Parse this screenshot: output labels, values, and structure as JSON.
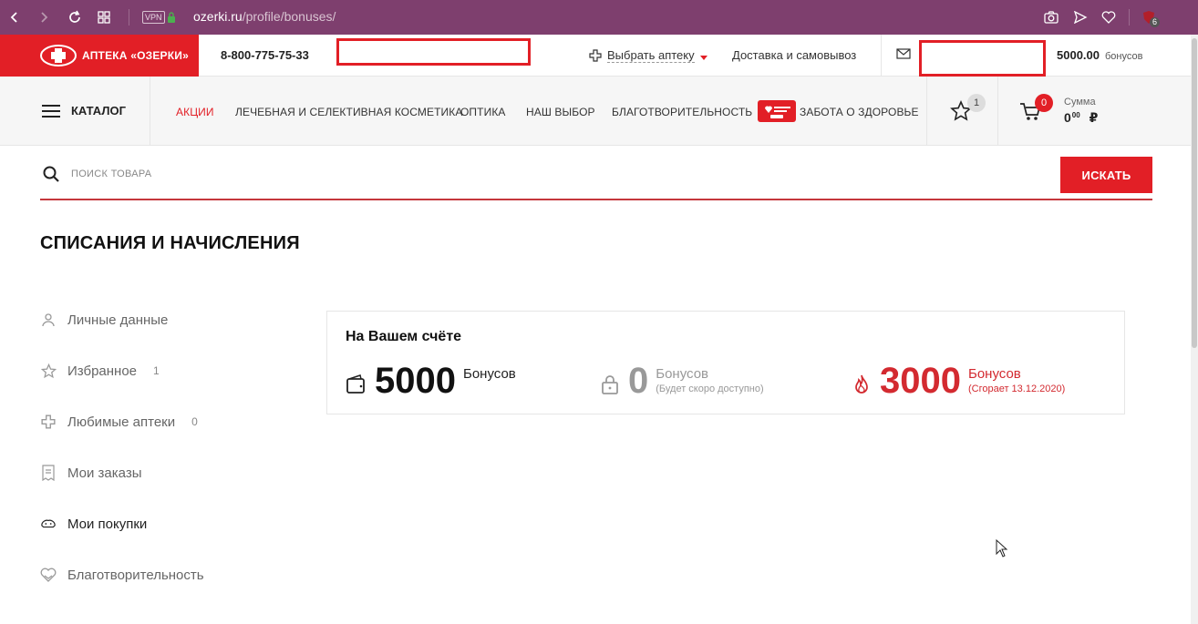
{
  "browser": {
    "url_host": "ozerki.ru",
    "url_path": "/profile/bonuses/",
    "vpn_label": "VPN",
    "extension_badge": "6"
  },
  "header": {
    "logo_text": "АПТЕКА «ОЗЕРКИ»",
    "phone": "8-800-775-75-33",
    "choose_pharmacy": "Выбрать аптеку",
    "delivery": "Доставка и самовывоз",
    "bonus_amount": "5000.00",
    "bonus_label": "бонусов"
  },
  "nav": {
    "catalog": "КАТАЛОГ",
    "items": [
      {
        "label": "АКЦИИ"
      },
      {
        "label": "ЛЕЧЕБНАЯ И СЕЛЕКТИВНАЯ КОСМЕТИКА"
      },
      {
        "label": "ОПТИКА"
      },
      {
        "label": "НАШ ВЫБОР"
      },
      {
        "label": "БЛАГОТВОРИТЕЛЬНОСТЬ"
      },
      {
        "label": "ЗАБОТА О ЗДОРОВЬЕ"
      }
    ],
    "favorites_count": "1",
    "cart_count": "0",
    "sum_label": "Сумма",
    "sum_value": "0",
    "sum_cents": "00",
    "currency": "₽"
  },
  "search": {
    "placeholder": "ПОИСК ТОВАРА",
    "button": "ИСКАТЬ"
  },
  "page": {
    "title": "СПИСАНИЯ И НАЧИСЛЕНИЯ"
  },
  "sidebar": {
    "items": [
      {
        "label": "Личные данные",
        "count": "",
        "icon": "user-icon"
      },
      {
        "label": "Избранное",
        "count": "1",
        "icon": "star-icon"
      },
      {
        "label": "Любимые аптеки",
        "count": "0",
        "icon": "cross-icon"
      },
      {
        "label": "Мои заказы",
        "count": "",
        "icon": "receipt-icon"
      },
      {
        "label": "Мои покупки",
        "count": "",
        "icon": "purchases-icon"
      },
      {
        "label": "Благотворительность",
        "count": "",
        "icon": "charity-icon"
      }
    ]
  },
  "bonus_card": {
    "title": "На Вашем счёте",
    "available": {
      "value": "5000",
      "label": "Бонусов"
    },
    "pending": {
      "value": "0",
      "label": "Бонусов",
      "note": "(Будет скоро доступно)"
    },
    "expiring": {
      "value": "3000",
      "label": "Бонусов",
      "note": "(Сгорает 13.12.2020)"
    }
  },
  "colors": {
    "brand_red": "#e21f26",
    "browser_purple": "#7e3f6e",
    "muted_gray": "#999999"
  }
}
